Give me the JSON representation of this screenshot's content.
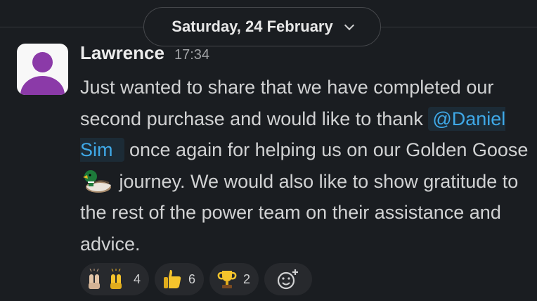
{
  "date_divider": {
    "label": "Saturday, 24 February"
  },
  "message": {
    "author": "Lawrence",
    "time": "17:34",
    "text_part1": "Just wanted to share that we have completed our second purchase and would like to thank ",
    "mention": "@Daniel Sim",
    "text_part2": " once again for helping us on our Golden Goose ",
    "text_part3": " journey. We would also like to show gratitude to the rest of the power team on their assistance and advice.",
    "inline_icon": "duck-icon"
  },
  "reactions": [
    {
      "icon": "raising-hands-icon",
      "count": "4"
    },
    {
      "icon": "thumbs-up-icon",
      "count": "6"
    },
    {
      "icon": "trophy-icon",
      "count": "2"
    }
  ],
  "add_reaction": {
    "icon": "add-emoji-icon"
  },
  "colors": {
    "background": "#1a1d21",
    "mention_text": "#3fa9e8",
    "avatar_purple": "#8b3aa8"
  }
}
